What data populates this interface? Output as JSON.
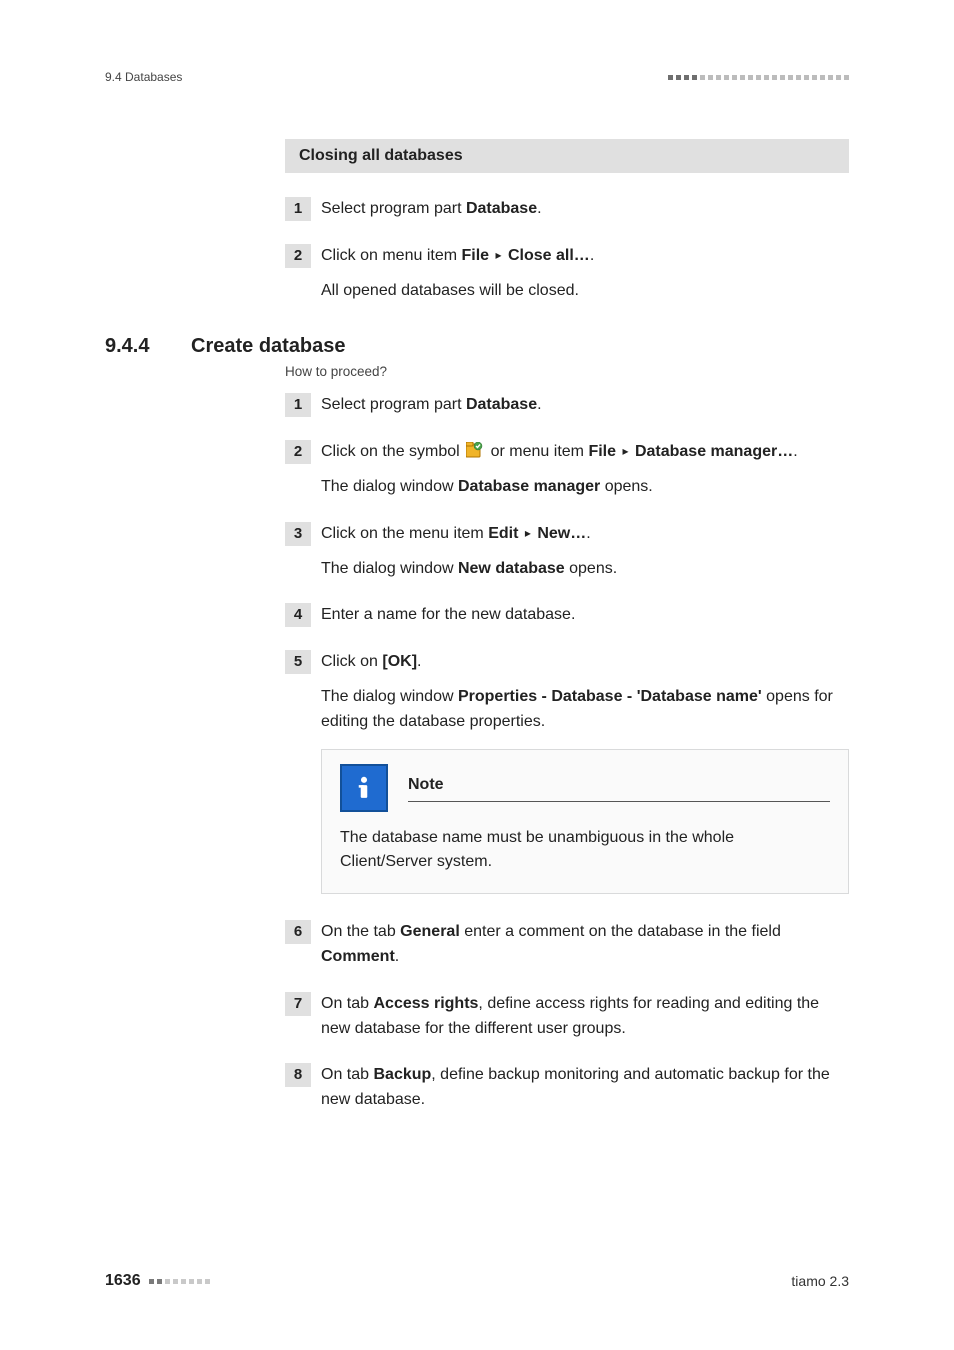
{
  "header": {
    "section_ref": "9.4 Databases"
  },
  "closing": {
    "title": "Closing all databases",
    "step1": {
      "pre": "Select program part ",
      "bold": "Database",
      "post": "."
    },
    "step2": {
      "line1_pre": "Click on menu item ",
      "line1_b1": "File",
      "line1_b2": "Close all…",
      "line1_post": ".",
      "line2": "All opened databases will be closed."
    }
  },
  "section": {
    "num": "9.4.4",
    "title": "Create database",
    "howto": "How to proceed?"
  },
  "steps": {
    "s1": {
      "pre": "Select program part ",
      "bold": "Database",
      "post": "."
    },
    "s2": {
      "l1_a": "Click on the symbol ",
      "l1_b": " or menu item ",
      "l1_b1": "File",
      "l1_b2": "Database manager…",
      "l1_post": ".",
      "l2_a": "The dialog window ",
      "l2_b": "Database manager",
      "l2_c": " opens."
    },
    "s3": {
      "l1_a": "Click on the menu item ",
      "l1_b1": "Edit",
      "l1_b2": "New…",
      "l1_post": ".",
      "l2_a": "The dialog window ",
      "l2_b": "New database",
      "l2_c": " opens."
    },
    "s4": "Enter a name for the new database.",
    "s5": {
      "l1_a": "Click on ",
      "l1_b": "[OK]",
      "l1_post": ".",
      "l2_a": "The dialog window ",
      "l2_b": "Properties - Database - 'Database name'",
      "l2_c": " opens for editing the database properties."
    },
    "note": {
      "title": "Note",
      "body": "The database name must be unambiguous in the whole Client/Server system."
    },
    "s6": {
      "a": "On the tab ",
      "b1": "General",
      "b": " enter a comment on the database in the field ",
      "b2": "Comment",
      "post": "."
    },
    "s7": {
      "a": "On tab ",
      "b1": "Access rights",
      "b": ", define access rights for reading and editing the new database for the different user groups."
    },
    "s8": {
      "a": "On tab ",
      "b1": "Backup",
      "b": ", define backup monitoring and automatic backup for the new database."
    }
  },
  "footer": {
    "page": "1636",
    "product": "tiamo 2.3"
  },
  "nums": {
    "n1": "1",
    "n2": "2",
    "n3": "3",
    "n4": "4",
    "n5": "5",
    "n6": "6",
    "n7": "7",
    "n8": "8"
  },
  "arrow": "▸"
}
